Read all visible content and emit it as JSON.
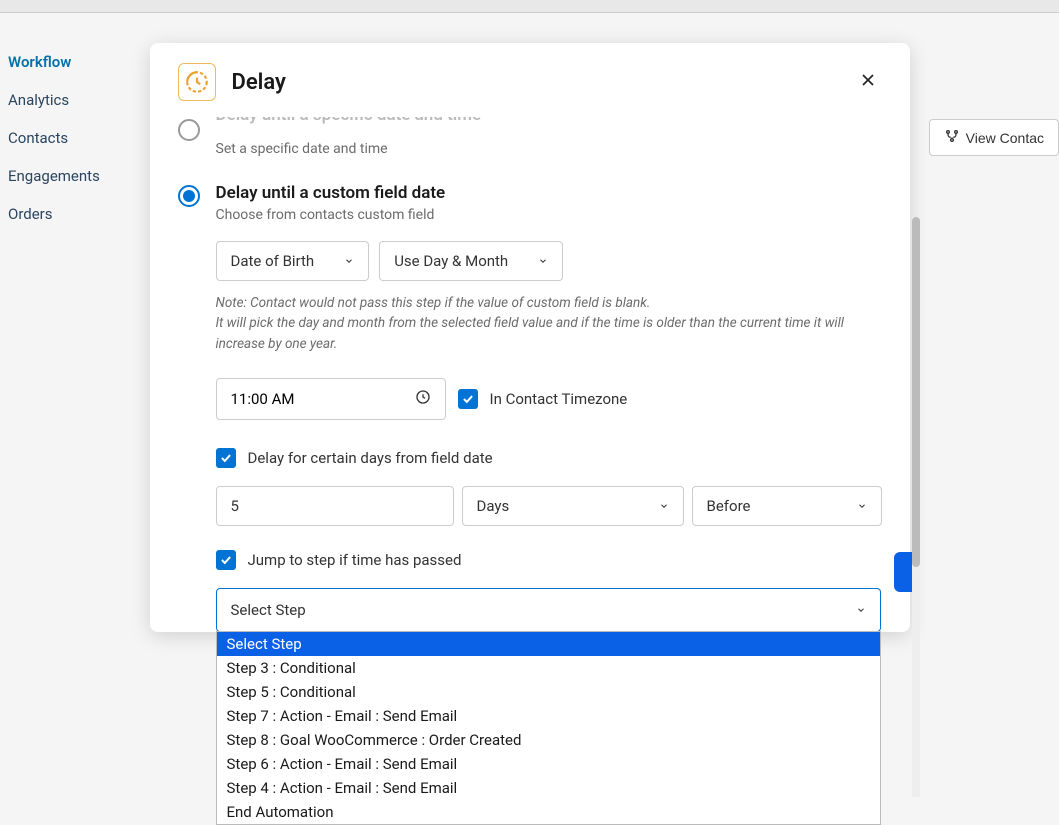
{
  "sidebar": {
    "items": [
      {
        "label": "Workflow",
        "active": true
      },
      {
        "label": "Analytics"
      },
      {
        "label": "Contacts"
      },
      {
        "label": "Engagements"
      },
      {
        "label": "Orders"
      }
    ]
  },
  "header_button": {
    "label": "View Contac"
  },
  "modal": {
    "title": "Delay",
    "option1": {
      "title": "Delay until a specific date and time",
      "desc": "Set a specific date and time"
    },
    "option2": {
      "title": "Delay until a custom field date",
      "desc": "Choose from contacts custom field"
    },
    "field_select": "Date of Birth",
    "mode_select": "Use Day & Month",
    "note_line1": "Note: Contact would not pass this step if the value of custom field is blank.",
    "note_line2": "It will pick the day and month from the selected field value and if the time is older than the current time it will increase by one year.",
    "time_value": "11:00 AM",
    "timezone_label": "In Contact Timezone",
    "delay_days_label": "Delay for certain days from field date",
    "days_value": "5",
    "days_unit": "Days",
    "days_direction": "Before",
    "jump_label": "Jump to step if time has passed",
    "step_select_placeholder": "Select Step",
    "dropdown_options": [
      "Select Step",
      "Step 3 : Conditional",
      "Step 5 : Conditional",
      "Step 7 : Action - Email : Send Email",
      "Step 8 : Goal WooCommerce : Order Created",
      "Step 6 : Action - Email : Send Email",
      "Step 4 : Action - Email : Send Email",
      "End Automation"
    ]
  }
}
